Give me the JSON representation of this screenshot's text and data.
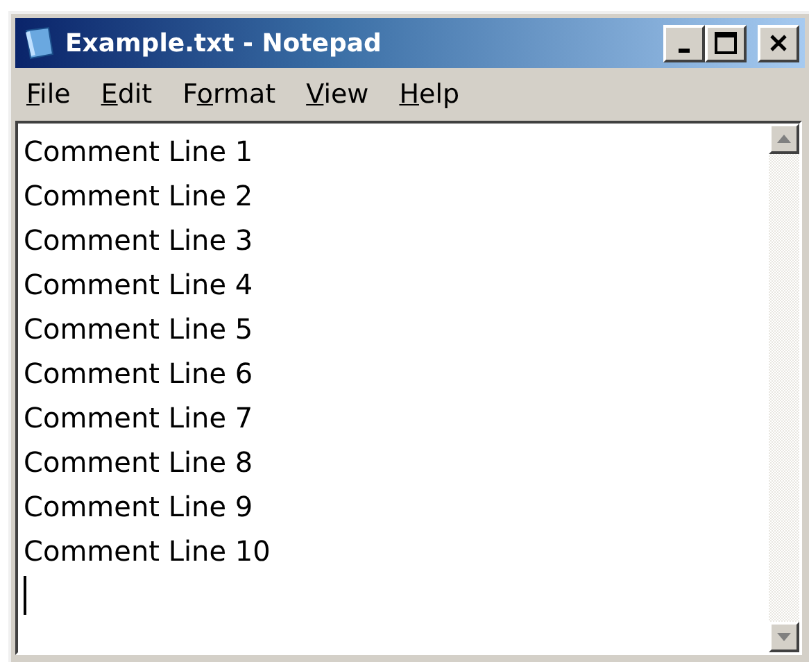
{
  "window": {
    "title": "Example.txt - Notepad"
  },
  "menu": [
    {
      "key": "F",
      "post": "ile"
    },
    {
      "key": "E",
      "post": "dit"
    },
    {
      "pre": "F",
      "key": "o",
      "post": "rmat"
    },
    {
      "key": "V",
      "post": "iew"
    },
    {
      "key": "H",
      "post": "elp"
    }
  ],
  "editor": {
    "lines": [
      "Comment Line 1",
      "Comment Line 2",
      "Comment Line 3",
      "Comment Line 4",
      "Comment Line 5",
      "Comment Line 6",
      "Comment Line 7",
      "Comment Line 8",
      "Comment Line 9",
      "Comment Line 10"
    ]
  }
}
